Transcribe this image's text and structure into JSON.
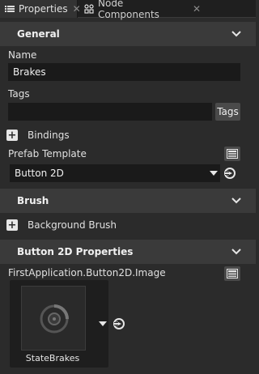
{
  "tabs": {
    "properties": "Properties",
    "node_components": "Node Components"
  },
  "sections": {
    "general": "General",
    "brush": "Brush",
    "button2d": "Button 2D Properties"
  },
  "general": {
    "name_label": "Name",
    "name_value": "Brakes",
    "tags_label": "Tags",
    "tags_value": "",
    "tags_button": "Tags",
    "bindings_label": "Bindings",
    "prefab_label": "Prefab Template",
    "prefab_value": "Button 2D"
  },
  "brush": {
    "background_brush_label": "Background Brush"
  },
  "button2d": {
    "image_property_label": "FirstApplication.Button2D.Image",
    "image_asset_name": "StateBrakes"
  },
  "colors": {
    "background": "#2b2b2b",
    "section_header": "#3a3a3a",
    "field": "#1a1a1a",
    "text": "#e6e6e6"
  }
}
